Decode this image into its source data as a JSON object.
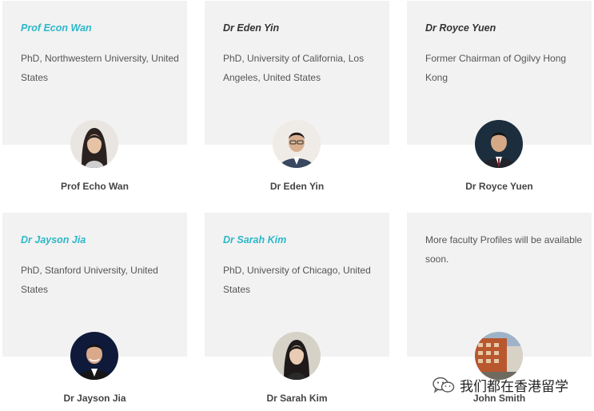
{
  "faculty": [
    {
      "role": "Prof Econ Wan",
      "description": "PhD, Northwestern University, United States",
      "name": "Prof Echo Wan",
      "highlighted": true
    },
    {
      "role": "Dr Eden Yin",
      "description": "PhD, University of California, Los Angeles, United States",
      "name": "Dr Eden Yin",
      "highlighted": false
    },
    {
      "role": "Dr Royce Yuen",
      "description": "Former Chairman of Ogilvy Hong Kong",
      "name": "Dr Royce Yuen",
      "highlighted": false
    },
    {
      "role": "Dr Jayson Jia",
      "description": "PhD, Stanford University, United States",
      "name": "Dr Jayson Jia",
      "highlighted": true
    },
    {
      "role": "Dr Sarah Kim",
      "description": "PhD, University of Chicago, United States",
      "name": "Dr Sarah Kim",
      "highlighted": true
    },
    {
      "role": "",
      "description": "More faculty Profiles will be available soon.",
      "name": "John Smith",
      "highlighted": false
    }
  ],
  "watermark": {
    "text": "我们都在香港留学",
    "icon": "wechat-icon"
  },
  "colors": {
    "accent": "#2db7c8",
    "panel": "#f2f2f2",
    "text": "#555555"
  }
}
